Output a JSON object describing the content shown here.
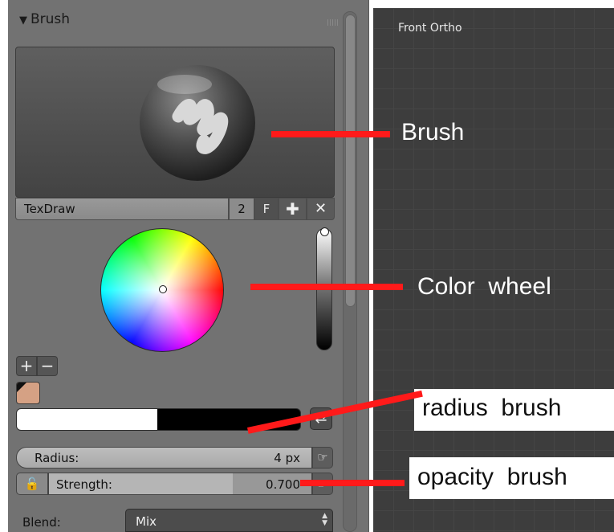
{
  "panel": {
    "title": "Brush",
    "brush_name": "TexDraw",
    "users_count": "2",
    "fake_user_label": "F",
    "add_icon": "plus-icon",
    "unlink_icon": "close-icon",
    "palette_add": "+",
    "palette_remove": "−",
    "radius_label": "Radius:",
    "radius_value": "4 px",
    "strength_label": "Strength:",
    "strength_value": "0.700",
    "blend_label": "Blend:",
    "blend_value": "Mix",
    "primary_color": "#ffffff",
    "secondary_color": "#000000",
    "swatch_color": "#d5a184"
  },
  "viewport": {
    "title": "Front Ortho"
  },
  "annotations": {
    "brush": "Brush",
    "color_wheel": "Color  wheel",
    "radius": "radius  brush",
    "opacity": "opacity  brush",
    "arrow_color": "#ff1a1a"
  }
}
